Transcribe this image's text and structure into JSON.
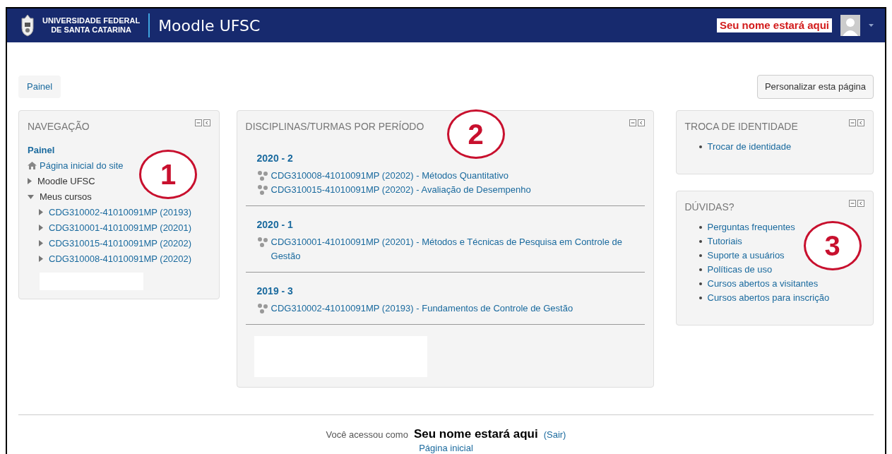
{
  "header": {
    "logo_text": [
      "UNIVERSIDADE FEDERAL",
      "DE SANTA CATARINA"
    ],
    "site_name": "Moodle UFSC",
    "user_name": "Seu nome estará aqui"
  },
  "breadcrumb": [
    {
      "label": "Painel"
    }
  ],
  "customize_button": "Personalizar esta página",
  "navigation": {
    "title": "NAVEGAÇÃO",
    "annotation": "1",
    "items": [
      {
        "label": "Painel",
        "kind": "current"
      },
      {
        "label": "Página inicial do site",
        "kind": "home"
      },
      {
        "label": "Moodle UFSC",
        "kind": "node",
        "expanded": false
      },
      {
        "label": "Meus cursos",
        "kind": "node",
        "expanded": true,
        "children": [
          {
            "label": "CDG310002-41010091MP (20193)",
            "kind": "node",
            "expanded": false
          },
          {
            "label": "CDG310001-41010091MP (20201)",
            "kind": "node",
            "expanded": false
          },
          {
            "label": "CDG310015-41010091MP (20202)",
            "kind": "node",
            "expanded": false
          },
          {
            "label": "CDG310008-41010091MP (20202)",
            "kind": "node",
            "expanded": false
          }
        ]
      }
    ]
  },
  "courses_block": {
    "title": "DISCIPLINAS/TURMAS POR PERÍODO",
    "annotation": "2",
    "periods": [
      {
        "label": "2020 - 2",
        "courses": [
          "CDG310008-41010091MP (20202) - Métodos Quantitativo",
          "CDG310015-41010091MP (20202) - Avaliação de Desempenho"
        ]
      },
      {
        "label": "2020 - 1",
        "courses": [
          "CDG310001-41010091MP (20201) - Métodos e Técnicas de Pesquisa em Controle de Gestão"
        ]
      },
      {
        "label": "2019 - 3",
        "courses": [
          "CDG310002-41010091MP (20193) - Fundamentos de Controle de Gestão"
        ]
      }
    ]
  },
  "identity_block": {
    "title": "TROCA DE IDENTIDADE",
    "links": [
      "Trocar de identidade"
    ]
  },
  "help_block": {
    "title": "DÚVIDAS?",
    "annotation": "3",
    "links": [
      "Perguntas frequentes",
      "Tutoriais",
      "Suporte a usuários",
      "Políticas de uso",
      "Cursos abertos a visitantes",
      "Cursos abertos para inscrição"
    ]
  },
  "footer": {
    "logged_in_text": "Você acessou como",
    "user_name": "Seu nome estará aqui",
    "logout": "(Sair)",
    "home_link": "Página inicial"
  }
}
